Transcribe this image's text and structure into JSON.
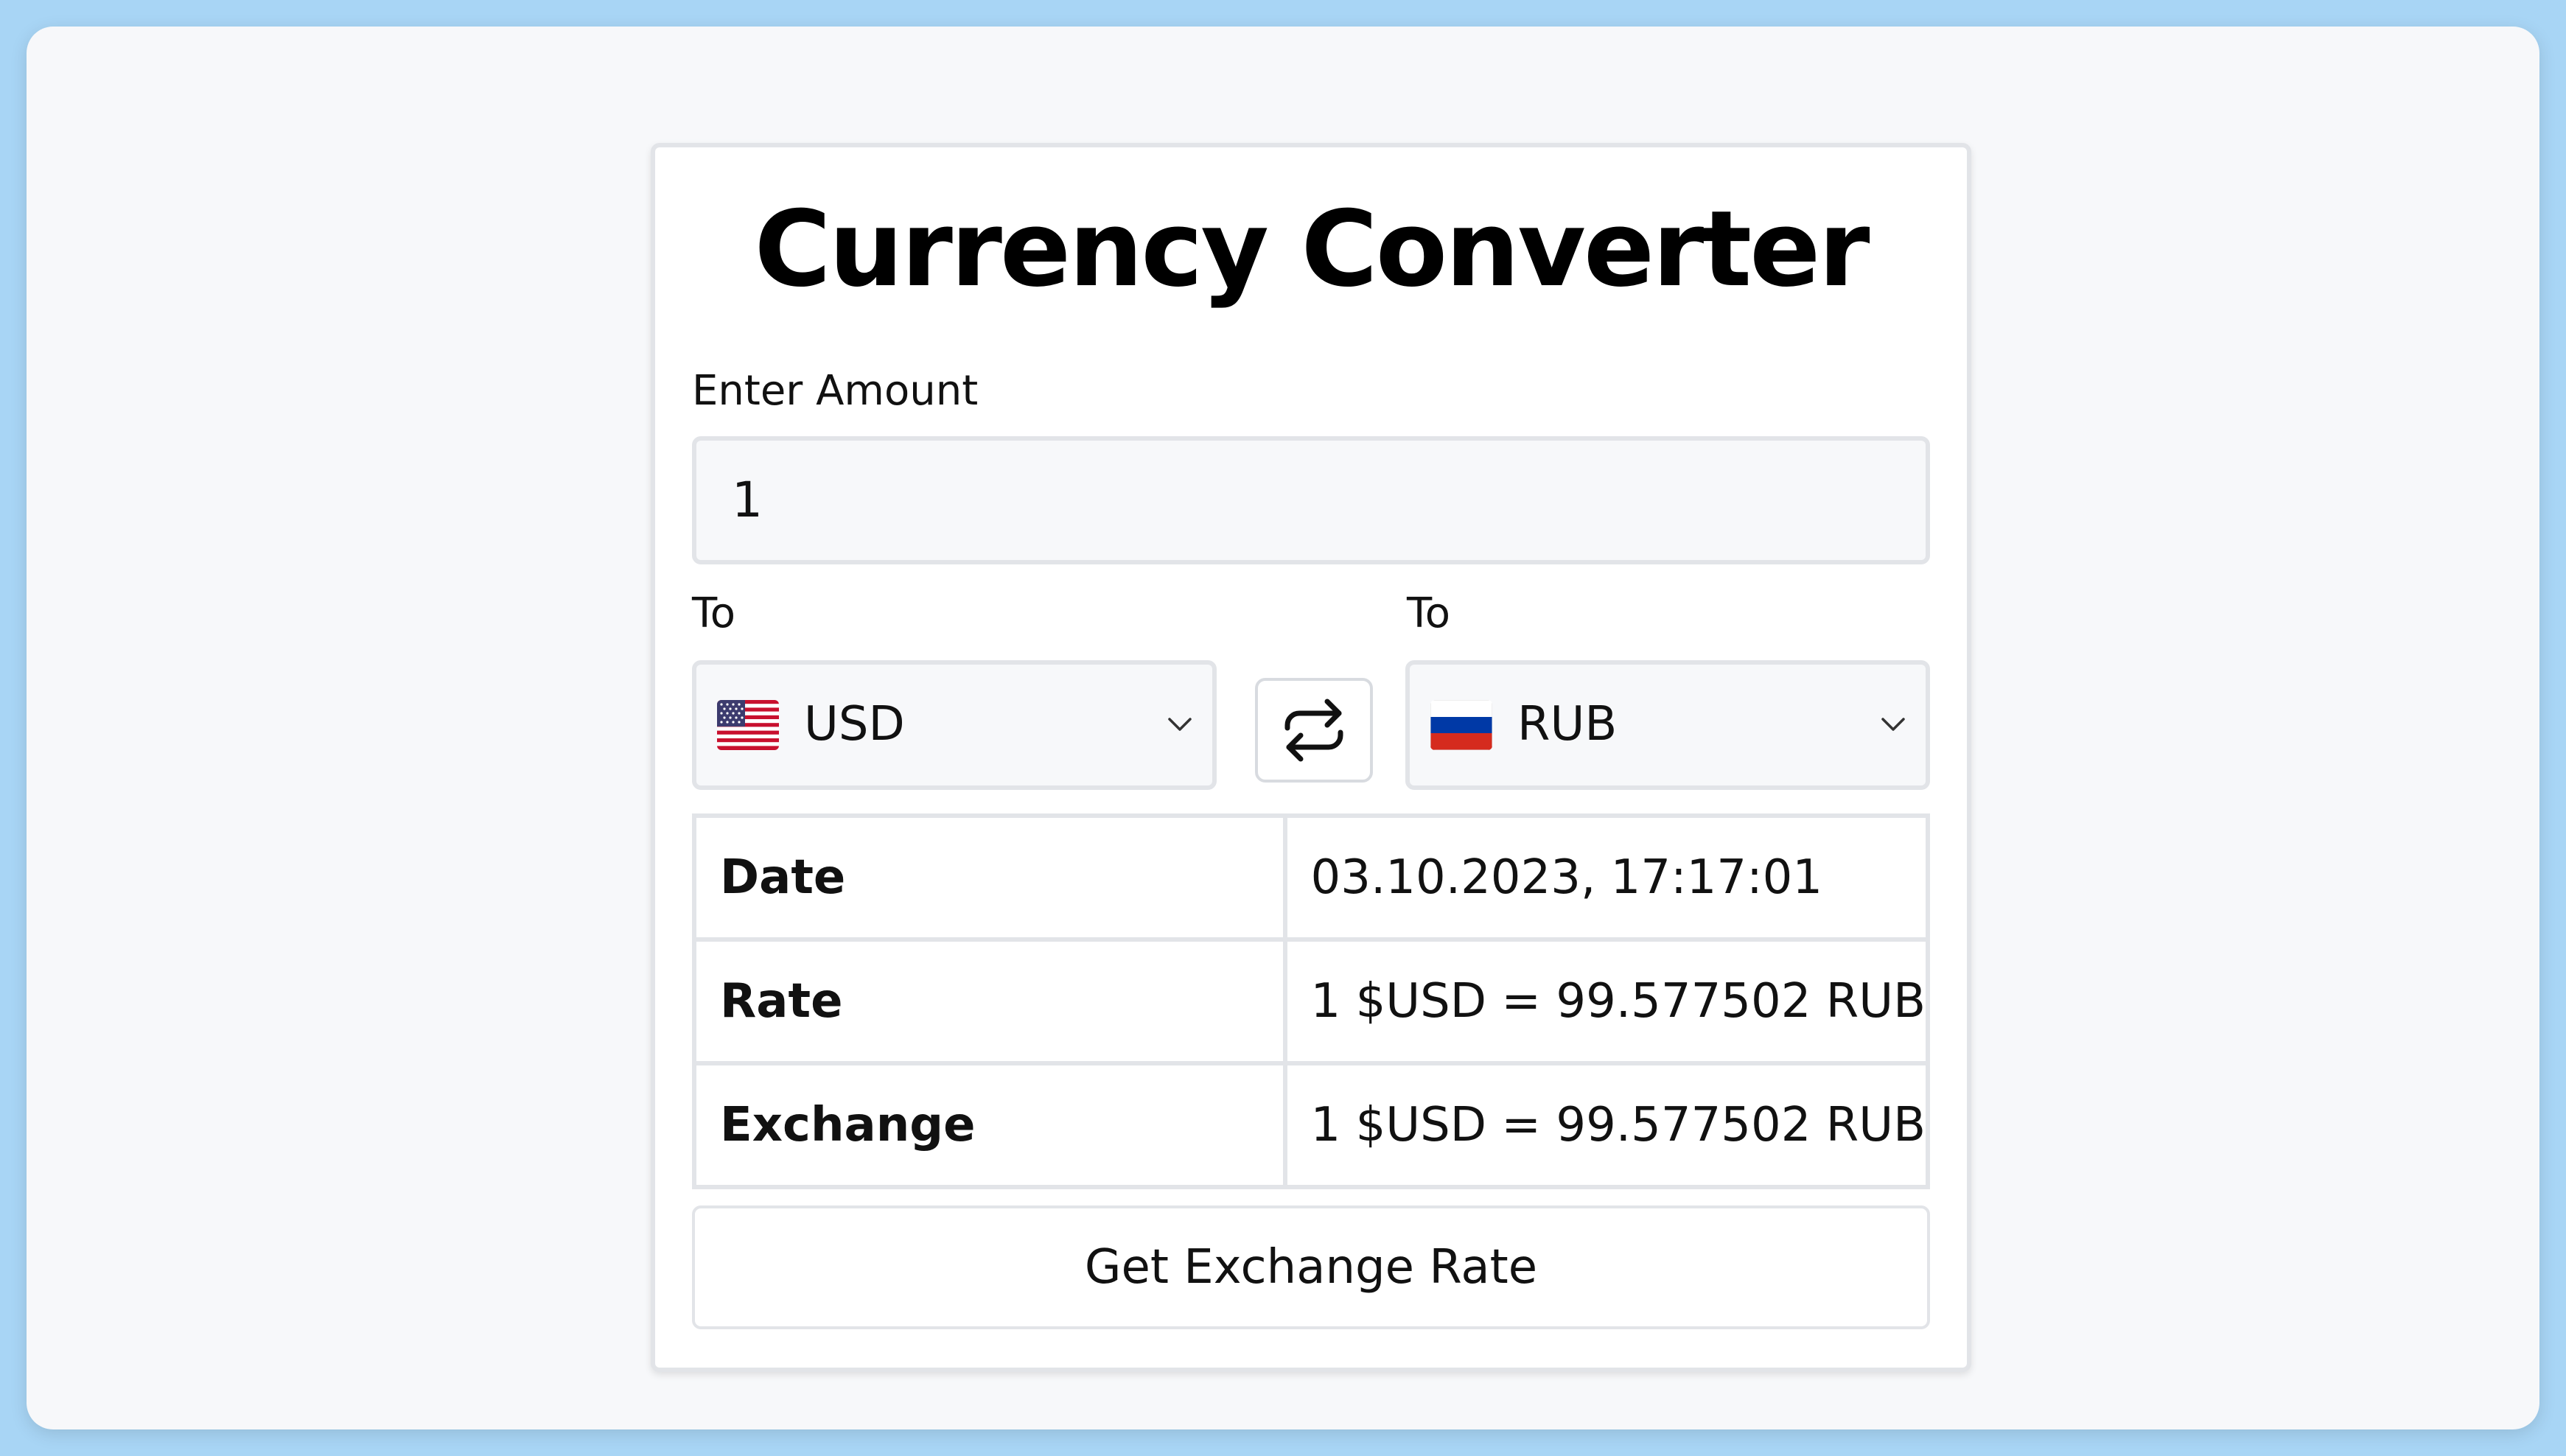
{
  "app": {
    "title": "Currency Converter"
  },
  "amount": {
    "label": "Enter Amount",
    "value": "1"
  },
  "from": {
    "label": "To",
    "currency": "USD",
    "flag_icon": "us-flag-icon"
  },
  "to": {
    "label": "To",
    "currency": "RUB",
    "flag_icon": "ru-flag-icon"
  },
  "swap": {
    "icon": "swap-arrows-icon"
  },
  "info": {
    "rows": [
      {
        "key": "Date",
        "value": "03.10.2023, 17:17:01"
      },
      {
        "key": "Rate",
        "value": "1 $USD = 99.577502 RUB"
      },
      {
        "key": "Exchange",
        "value": "1 $USD = 99.577502 RUB"
      }
    ]
  },
  "actions": {
    "get_rate_label": "Get Exchange Rate"
  },
  "colors": {
    "page_background": "#a8d5f5",
    "window_background": "#f7f8fa",
    "card_background": "#ffffff",
    "border": "#e2e4e8",
    "text": "#111111"
  }
}
